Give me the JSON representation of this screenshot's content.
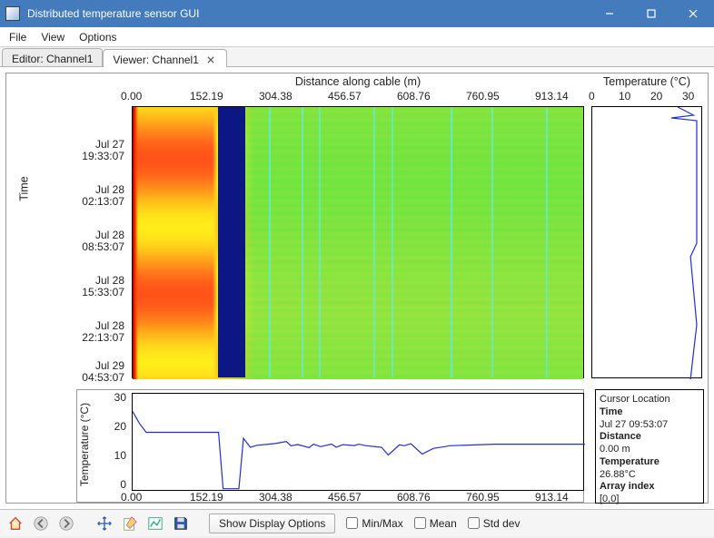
{
  "window": {
    "title": "Distributed temperature sensor GUI"
  },
  "menu": {
    "items": [
      "File",
      "View",
      "Options"
    ]
  },
  "tabs": [
    {
      "label": "Editor: Channel1",
      "active": false
    },
    {
      "label": "Viewer: Channel1",
      "active": true,
      "closable": true
    }
  ],
  "axes": {
    "x_title": "Distance along cable (m)",
    "x_ticks": [
      "0.00",
      "152.19",
      "304.38",
      "456.57",
      "608.76",
      "760.95",
      "913.14"
    ],
    "y_title": "Time",
    "y_ticks": [
      {
        "line1": "Jul 27",
        "line2": "19:33:07"
      },
      {
        "line1": "Jul 28",
        "line2": "02:13:07"
      },
      {
        "line1": "Jul 28",
        "line2": "08:53:07"
      },
      {
        "line1": "Jul 28",
        "line2": "15:33:07"
      },
      {
        "line1": "Jul 28",
        "line2": "22:13:07"
      },
      {
        "line1": "Jul 29",
        "line2": "04:53:07"
      }
    ],
    "temp_title": "Temperature (°C)",
    "temp_ticks": [
      "0",
      "10",
      "20",
      "30"
    ],
    "profile_y_title": "Temperature (°C)",
    "profile_y_ticks": [
      "0",
      "10",
      "20",
      "30"
    ],
    "profile_x_ticks": [
      "0.00",
      "152.19",
      "304.38",
      "456.57",
      "608.76",
      "760.95",
      "913.14"
    ]
  },
  "cursor": {
    "header": "Cursor Location",
    "time_label": "Time",
    "time_value": "Jul 27 09:53:07",
    "distance_label": "Distance",
    "distance_value": "0.00 m",
    "temperature_label": "Temperature",
    "temperature_value": "26.88°C",
    "arrayindex_label": "Array index",
    "arrayindex_value": "[0,0]"
  },
  "toolbar": {
    "show_display_options": "Show Display Options",
    "checkboxes": {
      "minmax": "Min/Max",
      "mean": "Mean",
      "stddev": "Std dev"
    }
  },
  "chart_data": {
    "type": "heatmap_with_profiles",
    "heatmap": {
      "x_range_m": [
        0,
        1000
      ],
      "timespan": [
        "Jul 27 09:53:07",
        "Jul 29 09:53:07"
      ],
      "colormap": "jet",
      "description": "Warm diurnal bands at x < ~180 m with cold dark-blue inclusion around x≈200–240 m; remainder ~15–18 °C with thin cyan vertical streaks."
    },
    "vertical_temperature_profile": {
      "type": "line",
      "xlabel": "Temperature (°C)",
      "xlim": [
        0,
        35
      ],
      "points": [
        [
          27,
          0.0
        ],
        [
          32,
          0.03
        ],
        [
          25,
          0.04
        ],
        [
          33,
          0.05
        ],
        [
          33,
          0.45
        ],
        [
          33,
          0.5
        ],
        [
          31,
          0.55
        ],
        [
          33,
          0.8
        ],
        [
          32,
          0.9
        ],
        [
          31,
          1.0
        ]
      ],
      "note": "y is fractional time from top(0) to bottom(1)"
    },
    "distance_profile": {
      "type": "line",
      "xlabel": "Distance (m)",
      "ylabel": "Temperature (°C)",
      "xlim": [
        0,
        1000
      ],
      "ylim": [
        0,
        33
      ],
      "points_m_c": [
        [
          0,
          27
        ],
        [
          15,
          23
        ],
        [
          30,
          20
        ],
        [
          120,
          20
        ],
        [
          190,
          20
        ],
        [
          200,
          1
        ],
        [
          235,
          1
        ],
        [
          245,
          18
        ],
        [
          260,
          15
        ],
        [
          300,
          16
        ],
        [
          350,
          15.5
        ],
        [
          400,
          16
        ],
        [
          450,
          15
        ],
        [
          500,
          16
        ],
        [
          550,
          15
        ],
        [
          600,
          15.5
        ],
        [
          700,
          15.5
        ],
        [
          800,
          16
        ],
        [
          900,
          16
        ],
        [
          1000,
          16
        ]
      ]
    }
  }
}
